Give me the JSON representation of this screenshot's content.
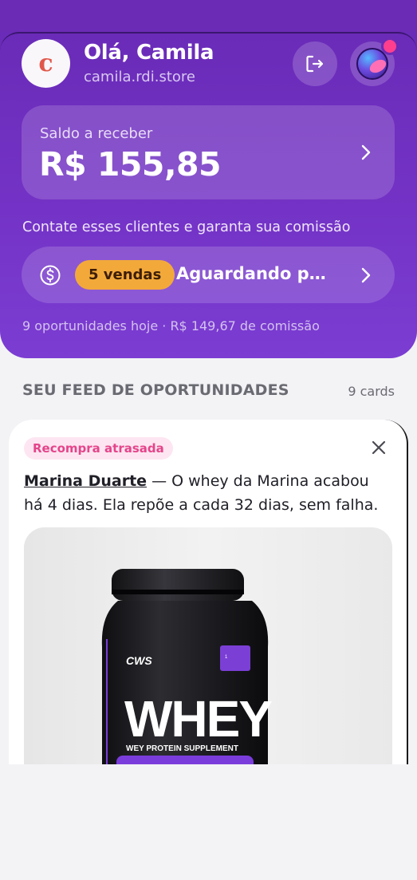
{
  "header": {
    "logo_letter": "c",
    "greeting": "Olá, Camila",
    "store": "camila.rdi.store"
  },
  "balance": {
    "label": "Saldo a receber",
    "value": "R$ 155,85"
  },
  "contact_text": "Contate esses clientes e garanta sua comissão",
  "sales": {
    "badge": "5 vendas",
    "status": "Aguardando pagamento"
  },
  "summary": "9 oportunidades hoje · R$ 149,67 de comissão",
  "feed": {
    "title": "SEU FEED DE OPORTUNIDADES",
    "count": "9 cards"
  },
  "card": {
    "tag": "Recompra atrasada",
    "customer": "Marina Duarte",
    "message": " — O whey da Marina acabou há 4 dias. Ela repõe a cada 32 dias, sem falha.",
    "product": {
      "brand": "CWS",
      "name": "WHEY",
      "subtitle": "WEY PROTEIN SUPPLEMENT"
    }
  },
  "colors": {
    "primary": "#6c2bb5",
    "badge": "#f3a93a",
    "tag_text": "#e4458b",
    "notification": "#ff3f8e"
  },
  "icons": [
    "logout-icon",
    "avatar-icon",
    "chevron-right-icon",
    "dollar-circle-icon",
    "close-icon"
  ]
}
